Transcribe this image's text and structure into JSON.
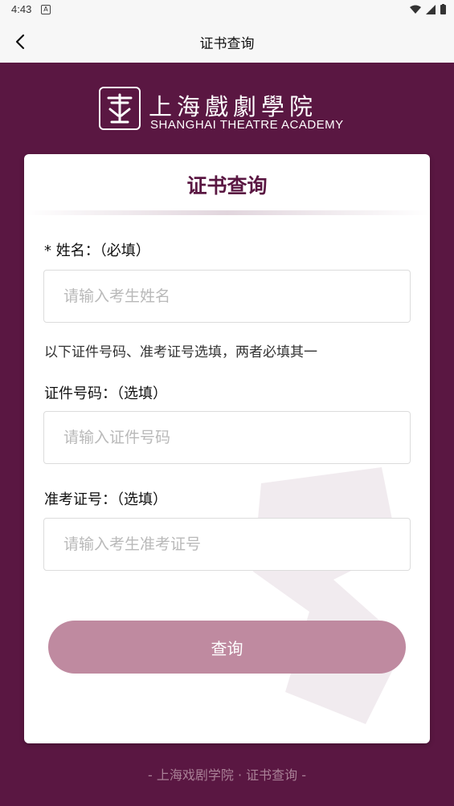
{
  "status_bar": {
    "time": "4:43",
    "notification_badge": "A"
  },
  "app_bar": {
    "title": "证书查询",
    "back_icon": "chevron-left-icon"
  },
  "logo": {
    "chinese_name": "上海戲劇學院",
    "english_name": "SHANGHAI THEATRE ACADEMY",
    "seal_icon": "theatre-seal-icon"
  },
  "card": {
    "title": "证书查询",
    "name_label": "* 姓名：（必填）",
    "name_placeholder": "请输入考生姓名",
    "hint": "以下证件号码、准考证号选填，两者必填其一",
    "id_label": "证件号码：（选填）",
    "id_placeholder": "请输入证件号码",
    "admission_label": "准考证号：（选填）",
    "admission_placeholder": "请输入考生准考证号",
    "submit_label": "查询"
  },
  "footer": {
    "text": "- 上海戏剧学院 · 证书查询 -"
  },
  "colors": {
    "brand": "#5a1742",
    "button": "#bf8aa0",
    "footer_text": "#a98096"
  }
}
